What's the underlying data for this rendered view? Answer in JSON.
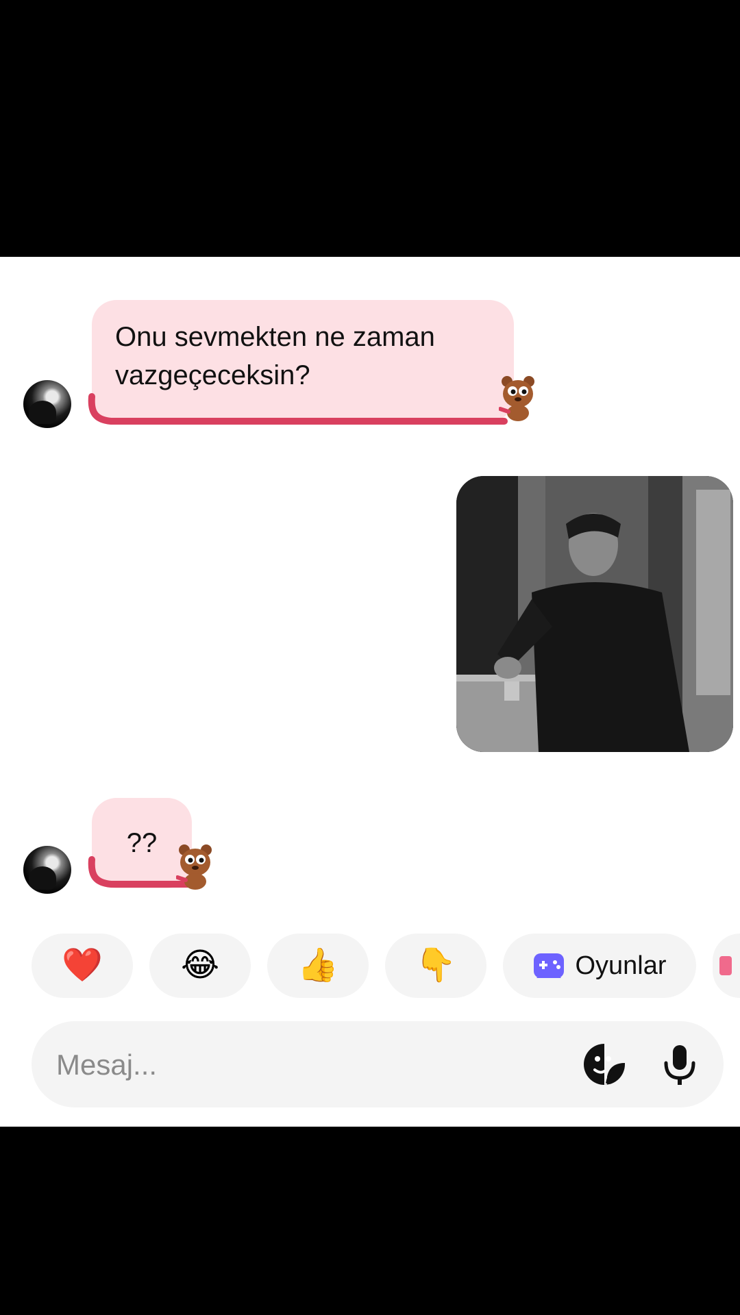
{
  "messages": [
    {
      "sender": "other",
      "lines": [
        "Onu sevmekten ne zaman",
        "vazgeçeceksin?"
      ]
    },
    {
      "sender": "me",
      "type": "image"
    },
    {
      "sender": "other",
      "text": "??"
    }
  ],
  "quick_reactions": [
    {
      "icon": "heart-emoji",
      "emoji": "❤️"
    },
    {
      "icon": "tears-of-joy-emoji",
      "emoji": "😂"
    },
    {
      "icon": "thumbs-up-emoji",
      "emoji": "👍"
    },
    {
      "icon": "pointing-down-emoji",
      "emoji": "👇"
    }
  ],
  "games_chip": {
    "label": "Oyunlar",
    "icon": "gamepad-icon"
  },
  "composer": {
    "placeholder": "Mesaj...",
    "sticker_icon": "sticker-icon",
    "mic_icon": "microphone-icon"
  },
  "colors": {
    "bubble": "#fde0e4",
    "underline": "#d9405f",
    "chip": "#f4f4f4",
    "games_icon": "#6d62ff"
  }
}
